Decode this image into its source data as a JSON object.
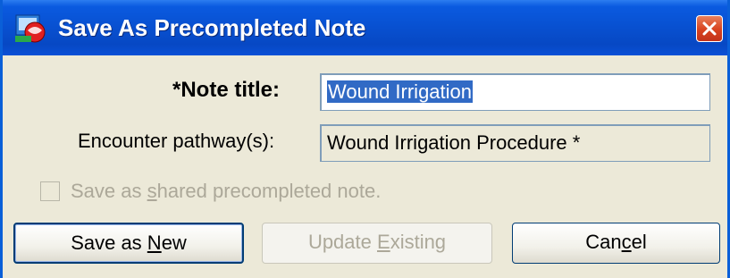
{
  "window": {
    "title": "Save As Precompleted Note",
    "icon": "app-icon",
    "close_icon": "close-icon"
  },
  "form": {
    "note_title_label": "*Note title:",
    "note_title_value": "Wound Irrigation",
    "pathway_label": "Encounter pathway(s):",
    "pathway_value": "Wound Irrigation Procedure *",
    "shared_checkbox": {
      "label_pre": "Save as ",
      "label_mn": "s",
      "label_post": "hared precompleted note.",
      "checked": false,
      "enabled": false
    }
  },
  "buttons": {
    "save_new": {
      "pre": "Save as ",
      "mn": "N",
      "post": "ew",
      "enabled": true
    },
    "update_existing": {
      "pre": "Update ",
      "mn": "E",
      "post": "xisting",
      "enabled": false
    },
    "cancel": {
      "pre": "Can",
      "mn": "c",
      "post": "el",
      "enabled": true
    }
  },
  "colors": {
    "titlebar": "#0a50d6",
    "dialog_bg": "#ece9d8",
    "selection": "#316ac5",
    "disabled_text": "#aca899",
    "close_button": "#d8421f"
  }
}
